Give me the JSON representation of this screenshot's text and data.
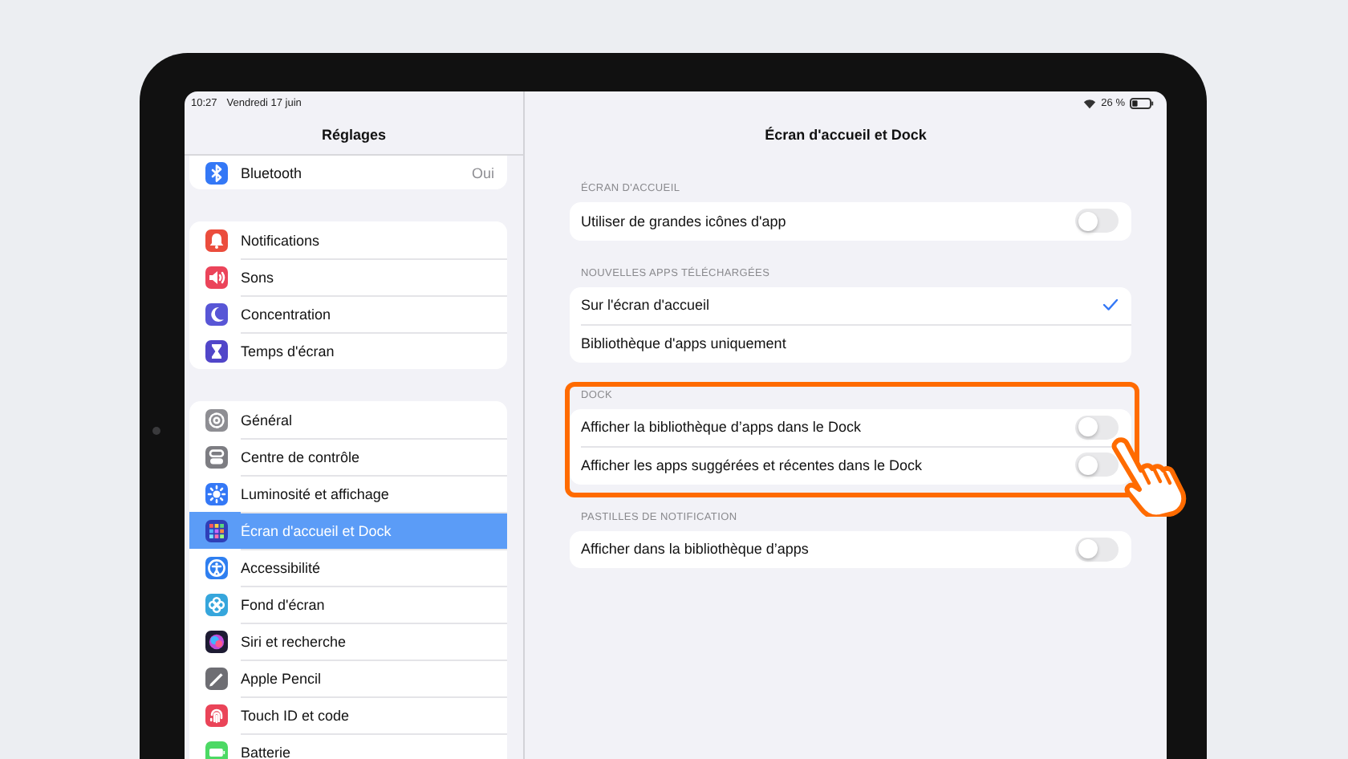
{
  "status_bar": {
    "time": "10:27",
    "date": "Vendredi 17 juin",
    "battery": "26 %"
  },
  "sidebar": {
    "title": "Réglages",
    "groups": [
      {
        "items": [
          {
            "label": "Bluetooth",
            "value": "Oui",
            "color": "#3478f6",
            "selected": false
          }
        ]
      },
      {
        "items": [
          {
            "label": "Notifications",
            "color": "#eb4d3d",
            "selected": false
          },
          {
            "label": "Sons",
            "color": "#eb445a",
            "selected": false
          },
          {
            "label": "Concentration",
            "color": "#5856d6",
            "selected": false
          },
          {
            "label": "Temps d'écran",
            "color": "#5146c9",
            "selected": false
          }
        ]
      },
      {
        "items": [
          {
            "label": "Général",
            "color": "#8e8e93",
            "selected": false
          },
          {
            "label": "Centre de contrôle",
            "color": "#7d7d82",
            "selected": false
          },
          {
            "label": "Luminosité et affichage",
            "color": "#3478f6",
            "selected": false
          },
          {
            "label": "Écran d'accueil et Dock",
            "color": "#2f3fb8",
            "selected": true
          },
          {
            "label": "Accessibilité",
            "color": "#2f7ff0",
            "selected": false
          },
          {
            "label": "Fond d'écran",
            "color": "#36a6dc",
            "selected": false
          },
          {
            "label": "Siri et recherche",
            "color": "#1d1b33",
            "selected": false
          },
          {
            "label": "Apple Pencil",
            "color": "#6e6e73",
            "selected": false
          },
          {
            "label": "Touch ID et code",
            "color": "#ea4458",
            "selected": false
          },
          {
            "label": "Batterie",
            "color": "#4cd964",
            "selected": false
          }
        ]
      }
    ]
  },
  "detail": {
    "title": "Écran d'accueil et Dock",
    "sections": [
      {
        "header": "ÉCRAN D'ACCUEIL",
        "highlighted": false,
        "rows": [
          {
            "label": "Utiliser de grandes icônes d'app",
            "kind": "toggle",
            "on": false
          }
        ]
      },
      {
        "header": "NOUVELLES APPS TÉLÉCHARGÉES",
        "highlighted": false,
        "rows": [
          {
            "label": "Sur l'écran d'accueil",
            "kind": "choice",
            "selected": true
          },
          {
            "label": "Bibliothèque d'apps uniquement",
            "kind": "choice",
            "selected": false
          }
        ]
      },
      {
        "header": "DOCK",
        "highlighted": true,
        "rows": [
          {
            "label": "Afficher la bibliothèque d’apps dans le Dock",
            "kind": "toggle",
            "on": false
          },
          {
            "label": "Afficher les apps suggérées et récentes dans le Dock",
            "kind": "toggle",
            "on": false
          }
        ]
      },
      {
        "header": "PASTILLES DE NOTIFICATION",
        "highlighted": false,
        "rows": [
          {
            "label": "Afficher dans la bibliothèque d’apps",
            "kind": "toggle",
            "on": false
          }
        ]
      }
    ]
  }
}
